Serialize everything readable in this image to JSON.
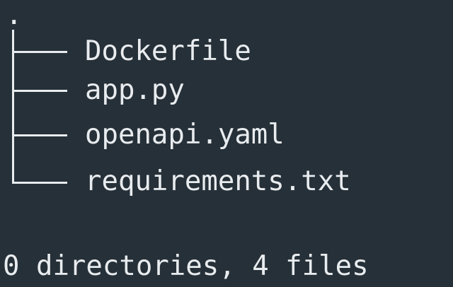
{
  "tree": {
    "root": ".",
    "entries": [
      {
        "name": "Dockerfile"
      },
      {
        "name": "app.py"
      },
      {
        "name": "openapi.yaml"
      },
      {
        "name": "requirements.txt"
      }
    ],
    "summary": "0 directories, 4 files"
  },
  "colors": {
    "background": "#263038",
    "foreground": "#e8ecef"
  }
}
